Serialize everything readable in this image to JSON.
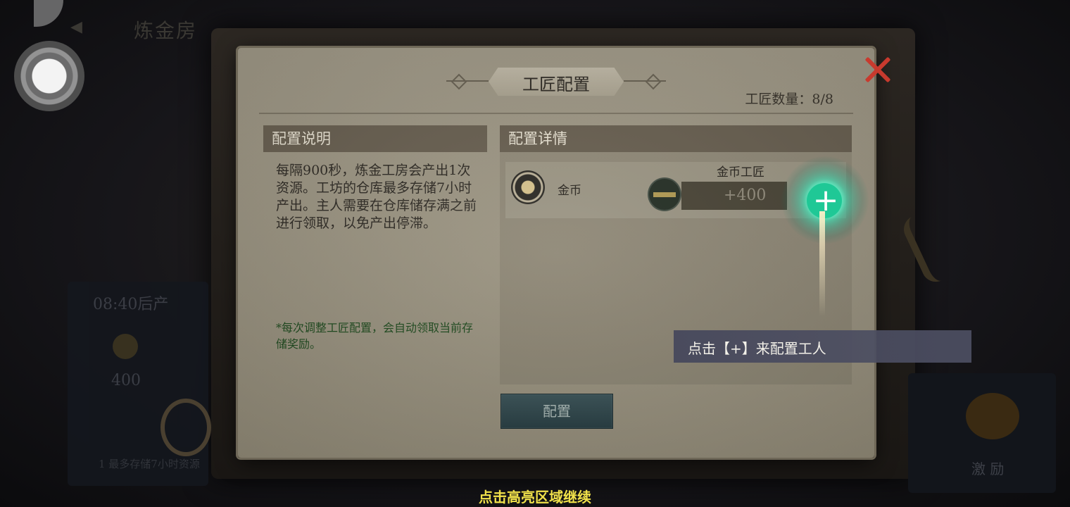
{
  "background": {
    "title": "炼金房",
    "left_timer": "08:40后产",
    "left_value": "400",
    "left_note": "1  最多存储7小时资源",
    "right_label": "激  励"
  },
  "dialog": {
    "title": "工匠配置",
    "count_label": "工匠数量：8/8",
    "left_panel": {
      "header": "配置说明",
      "description": "每隔900秒，炼金工房会产出1次资源。工坊的仓库最多存储7小时产出。主人需要在仓库储存满之前进行领取，以免产出停滞。",
      "tip": "*每次调整工匠配置，会自动领取当前存储奖励。"
    },
    "right_panel": {
      "header": "配置详情",
      "resource_label": "金币",
      "worker_label": "金币工匠",
      "worker_output": "+400",
      "add_symbol": "+"
    },
    "config_button": "配置"
  },
  "tooltip": "点击【+】来配置工人",
  "bottom_hint": "点击高亮区域继续",
  "colors": {
    "hint_yellow": "#f0e14a",
    "close_red": "#c83a2e",
    "glow_teal": "#1fc896",
    "parchment": "#a39c8a"
  }
}
